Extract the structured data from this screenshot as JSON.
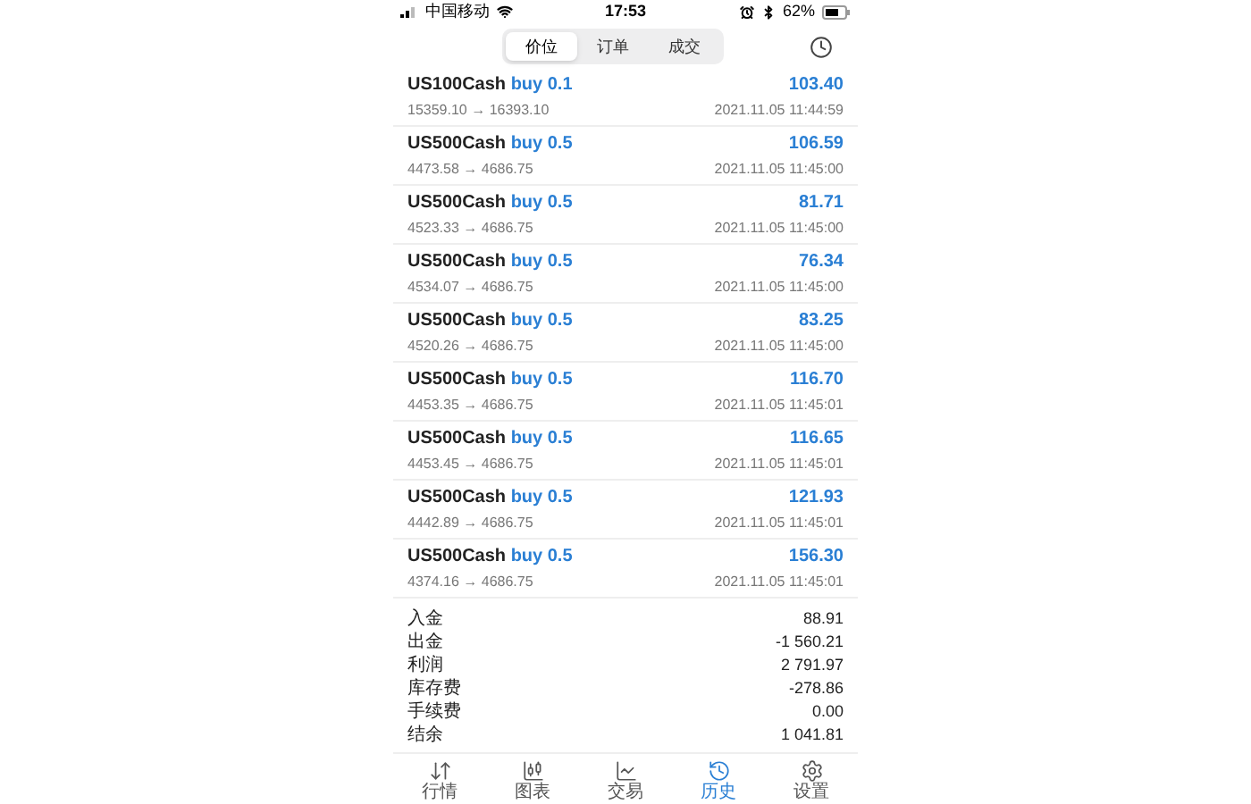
{
  "status_bar": {
    "carrier": "中国移动",
    "time": "17:53",
    "battery": "62%"
  },
  "segments": [
    {
      "label": "价位",
      "selected": true
    },
    {
      "label": "订单",
      "selected": false
    },
    {
      "label": "成交",
      "selected": false
    }
  ],
  "trades": [
    {
      "symbol": "US100Cash",
      "side": "buy 0.1",
      "prices": "15359.10 → 16393.10",
      "profit": "103.40",
      "time": "2021.11.05 11:44:59"
    },
    {
      "symbol": "US500Cash",
      "side": "buy 0.5",
      "prices": "4473.58 → 4686.75",
      "profit": "106.59",
      "time": "2021.11.05 11:45:00"
    },
    {
      "symbol": "US500Cash",
      "side": "buy 0.5",
      "prices": "4523.33 → 4686.75",
      "profit": "81.71",
      "time": "2021.11.05 11:45:00"
    },
    {
      "symbol": "US500Cash",
      "side": "buy 0.5",
      "prices": "4534.07 → 4686.75",
      "profit": "76.34",
      "time": "2021.11.05 11:45:00"
    },
    {
      "symbol": "US500Cash",
      "side": "buy 0.5",
      "prices": "4520.26 → 4686.75",
      "profit": "83.25",
      "time": "2021.11.05 11:45:00"
    },
    {
      "symbol": "US500Cash",
      "side": "buy 0.5",
      "prices": "4453.35 → 4686.75",
      "profit": "116.70",
      "time": "2021.11.05 11:45:01"
    },
    {
      "symbol": "US500Cash",
      "side": "buy 0.5",
      "prices": "4453.45 → 4686.75",
      "profit": "116.65",
      "time": "2021.11.05 11:45:01"
    },
    {
      "symbol": "US500Cash",
      "side": "buy 0.5",
      "prices": "4442.89 → 4686.75",
      "profit": "121.93",
      "time": "2021.11.05 11:45:01"
    },
    {
      "symbol": "US500Cash",
      "side": "buy 0.5",
      "prices": "4374.16 → 4686.75",
      "profit": "156.30",
      "time": "2021.11.05 11:45:01"
    }
  ],
  "summary": [
    {
      "label": "入金",
      "value": "88.91"
    },
    {
      "label": "出金",
      "value": "-1 560.21"
    },
    {
      "label": "利润",
      "value": "2 791.97"
    },
    {
      "label": "库存费",
      "value": "-278.86"
    },
    {
      "label": "手续费",
      "value": "0.00"
    },
    {
      "label": "结余",
      "value": "1 041.81"
    }
  ],
  "tab_bar": [
    {
      "label": "行情",
      "kind": "quotes",
      "selected": false
    },
    {
      "label": "图表",
      "kind": "chart",
      "selected": false
    },
    {
      "label": "交易",
      "kind": "trade",
      "selected": false
    },
    {
      "label": "历史",
      "kind": "history",
      "selected": true
    },
    {
      "label": "设置",
      "kind": "settings",
      "selected": false
    }
  ]
}
